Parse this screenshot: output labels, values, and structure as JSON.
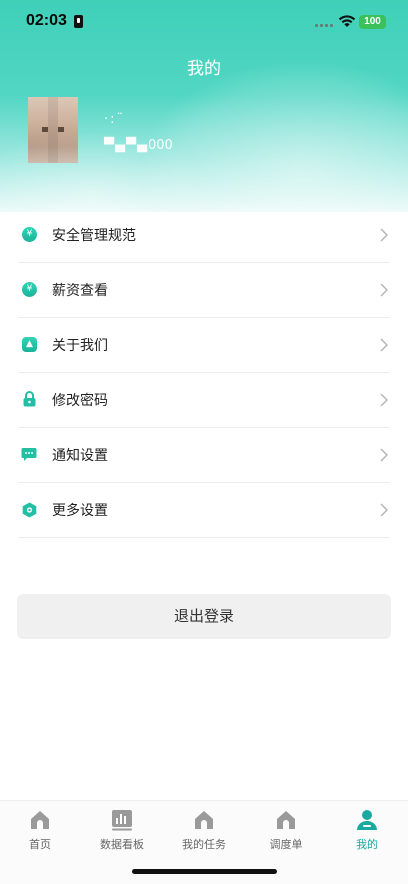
{
  "status_bar": {
    "time": "02:03",
    "battery": "100"
  },
  "header": {
    "title": "我的",
    "username": "·:¨",
    "user_id_mask": "▀▄▀▄",
    "user_id_suffix": "000"
  },
  "menu": [
    {
      "label": "安全管理规范",
      "icon": "yen-icon",
      "glyph": "¥"
    },
    {
      "label": "薪资查看",
      "icon": "yen-icon",
      "glyph": "¥"
    },
    {
      "label": "关于我们",
      "icon": "info-icon",
      "glyph": "▲"
    },
    {
      "label": "修改密码",
      "icon": "lock-icon",
      "glyph": ""
    },
    {
      "label": "通知设置",
      "icon": "message-icon",
      "glyph": "···"
    },
    {
      "label": "更多设置",
      "icon": "settings-icon",
      "glyph": "◎"
    }
  ],
  "logout_label": "退出登录",
  "tabs": [
    {
      "label": "首页",
      "icon": "home-icon"
    },
    {
      "label": "数据看板",
      "icon": "chart-board-icon"
    },
    {
      "label": "我的任务",
      "icon": "task-icon"
    },
    {
      "label": "调度单",
      "icon": "dispatch-icon"
    },
    {
      "label": "我的",
      "icon": "profile-icon",
      "active": true
    }
  ],
  "colors": {
    "accent": "#1aa9a0",
    "header_top": "#3fd0b8",
    "icon_green": "#22bfa4"
  }
}
